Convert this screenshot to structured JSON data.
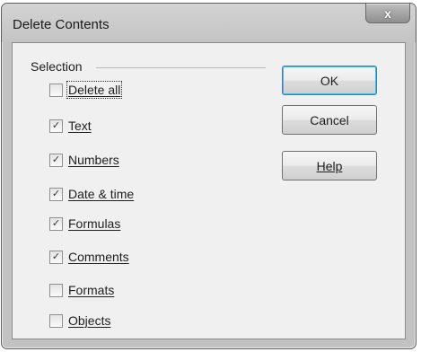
{
  "dialog": {
    "title": "Delete Contents",
    "close_label": "x"
  },
  "selection": {
    "group_label": "Selection",
    "options": [
      {
        "label": "Delete all",
        "checked": false
      },
      {
        "label": "Text",
        "checked": true
      },
      {
        "label": "Numbers",
        "checked": true
      },
      {
        "label": "Date & time",
        "checked": true
      },
      {
        "label": "Formulas",
        "checked": true
      },
      {
        "label": "Comments",
        "checked": true
      },
      {
        "label": "Formats",
        "checked": false
      },
      {
        "label": "Objects",
        "checked": false
      }
    ]
  },
  "buttons": {
    "ok": "OK",
    "cancel": "Cancel",
    "help": "Help"
  }
}
